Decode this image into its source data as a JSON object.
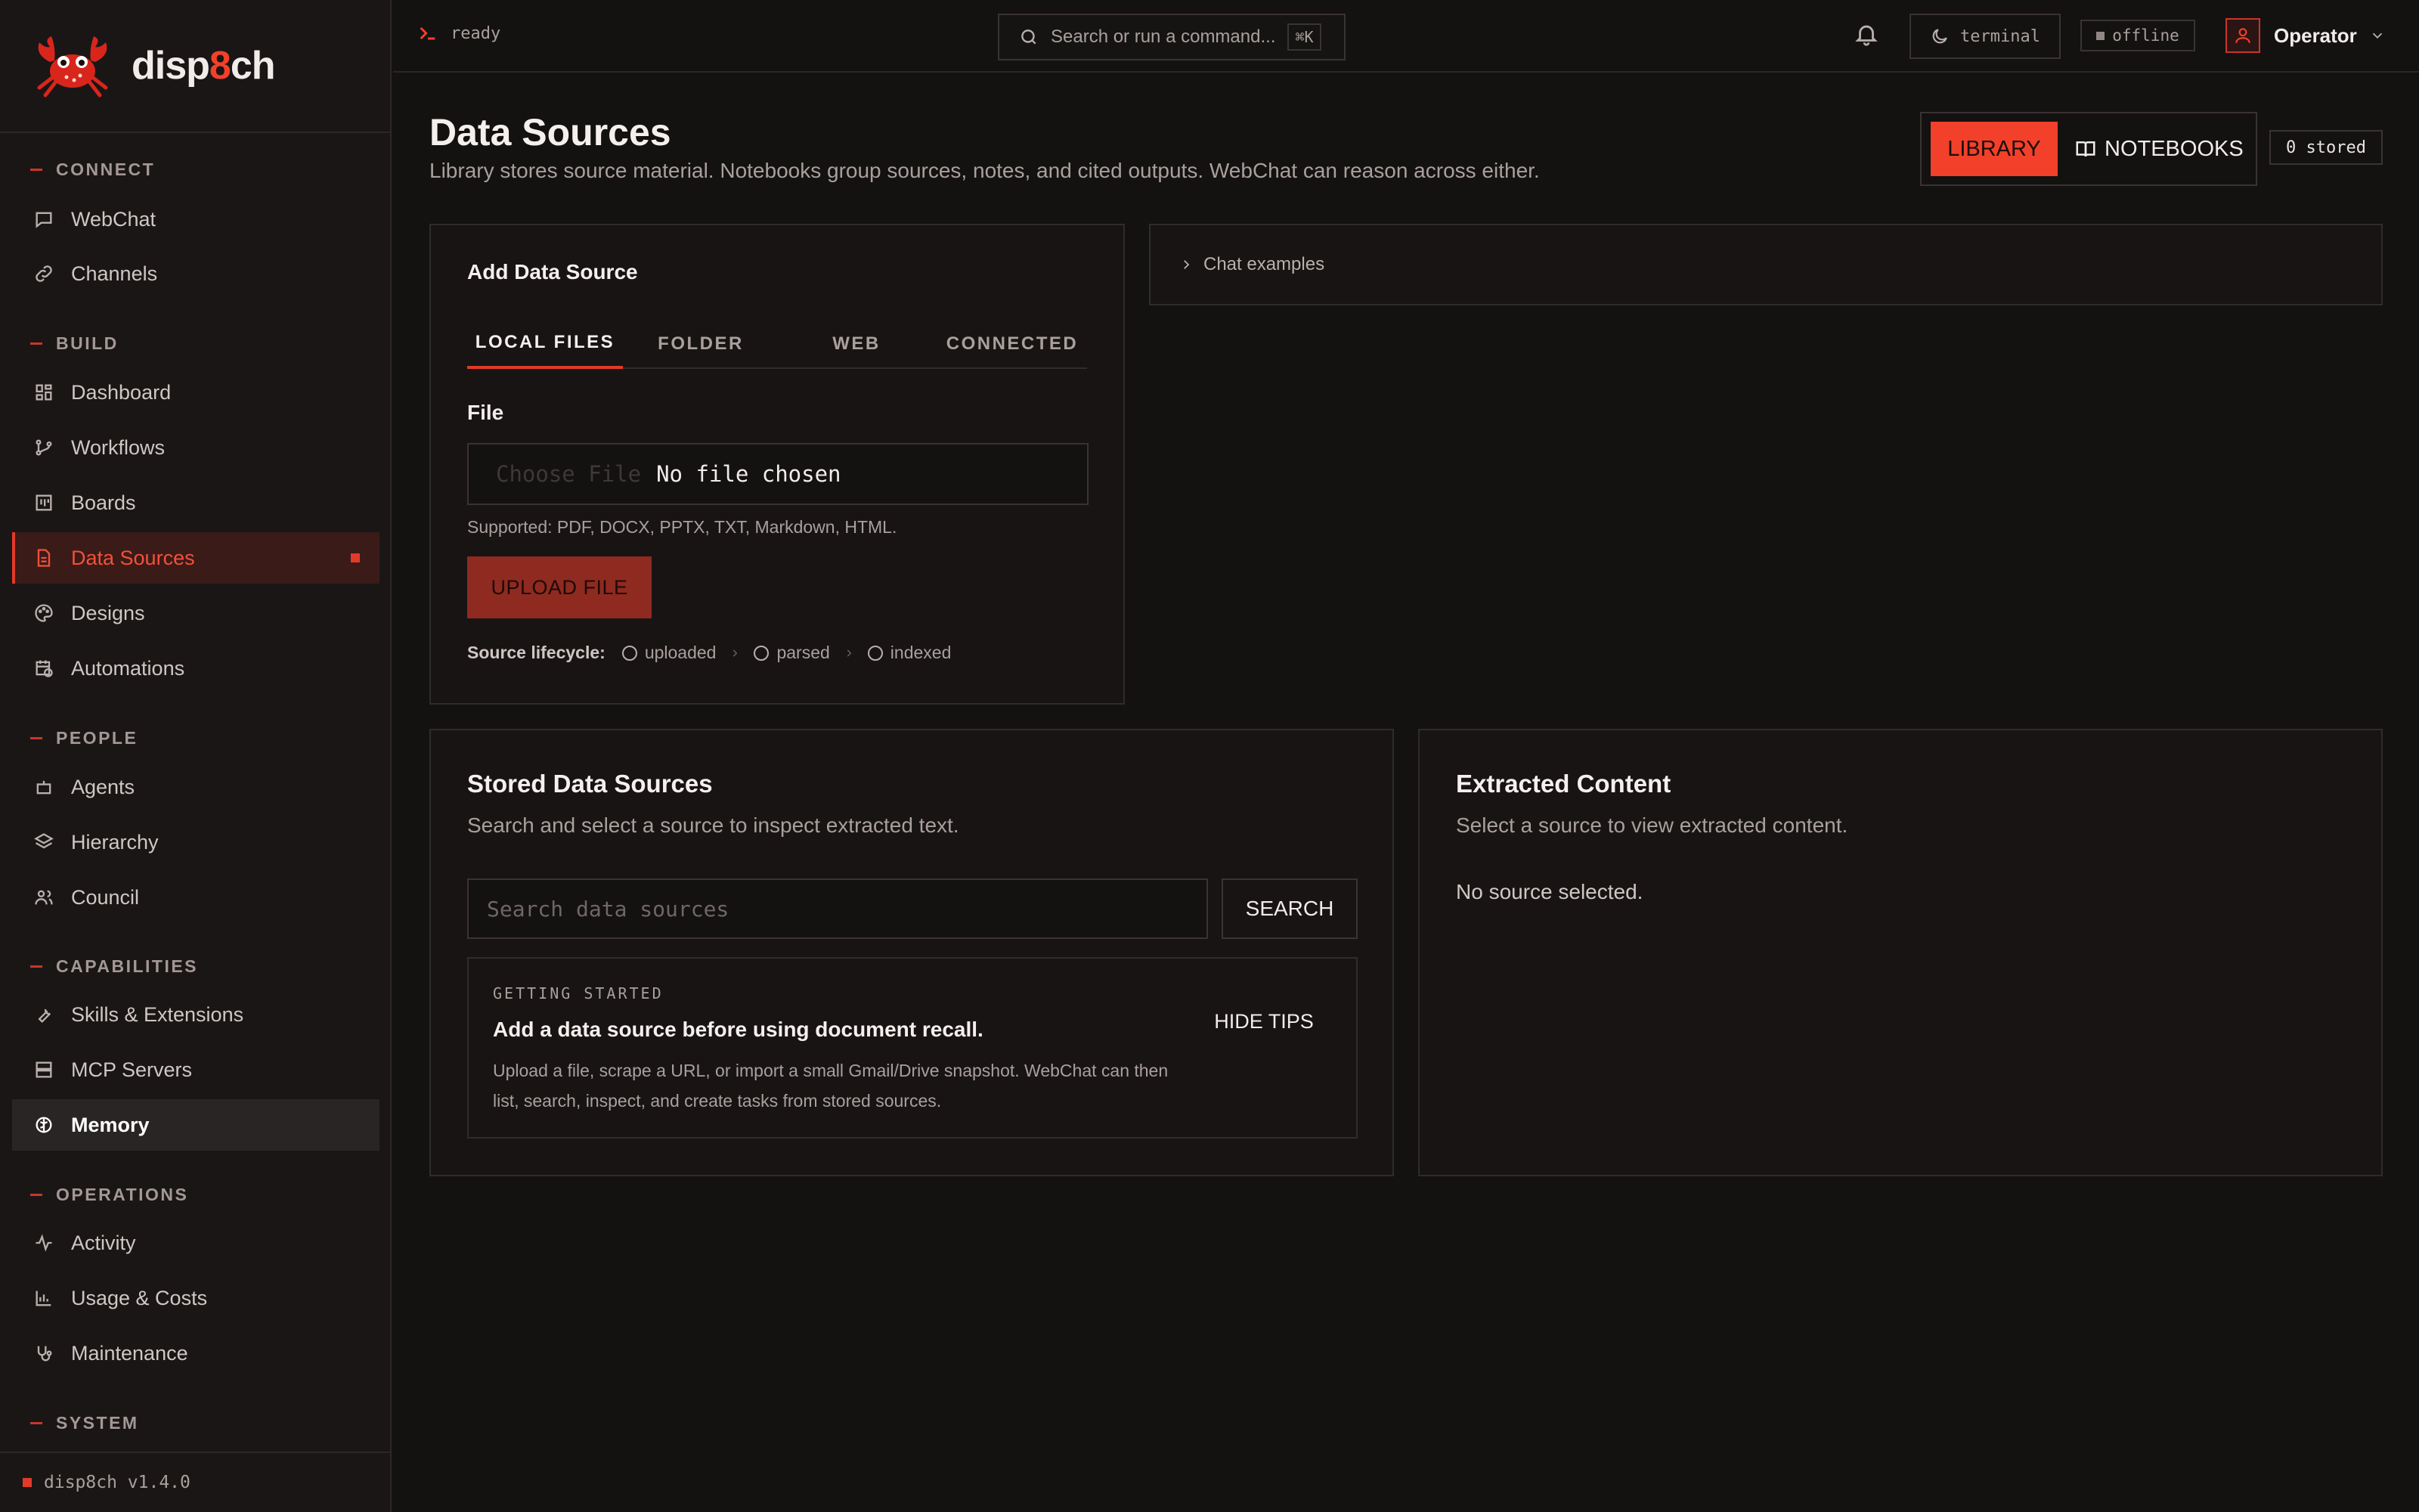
{
  "brand": {
    "name_prefix": "disp",
    "name_accent": "8",
    "name_suffix": "ch"
  },
  "sidebar": {
    "sections": {
      "connect": "CONNECT",
      "build": "BUILD",
      "people": "PEOPLE",
      "capabilities": "CAPABILITIES",
      "operations": "OPERATIONS",
      "system": "SYSTEM"
    },
    "items": {
      "webchat": {
        "label": "WebChat",
        "icon": "chat-icon"
      },
      "channels": {
        "label": "Channels",
        "icon": "link-icon"
      },
      "dashboard": {
        "label": "Dashboard",
        "icon": "grid-icon"
      },
      "workflows": {
        "label": "Workflows",
        "icon": "branch-icon"
      },
      "boards": {
        "label": "Boards",
        "icon": "board-icon"
      },
      "data_sources": {
        "label": "Data Sources",
        "icon": "document-icon",
        "active": true
      },
      "designs": {
        "label": "Designs",
        "icon": "palette-icon"
      },
      "automations": {
        "label": "Automations",
        "icon": "calendar-clock-icon"
      },
      "agents": {
        "label": "Agents",
        "icon": "robot-icon"
      },
      "hierarchy": {
        "label": "Hierarchy",
        "icon": "layers-icon"
      },
      "council": {
        "label": "Council",
        "icon": "users-icon"
      },
      "skills": {
        "label": "Skills & Extensions",
        "icon": "wrench-icon"
      },
      "mcp": {
        "label": "MCP Servers",
        "icon": "server-icon"
      },
      "memory": {
        "label": "Memory",
        "icon": "brain-icon"
      },
      "activity": {
        "label": "Activity",
        "icon": "pulse-icon"
      },
      "usage": {
        "label": "Usage & Costs",
        "icon": "bar-chart-icon"
      },
      "maintenance": {
        "label": "Maintenance",
        "icon": "stethoscope-icon"
      }
    },
    "version": "disp8ch v1.4.0"
  },
  "topbar": {
    "status": "ready",
    "search_placeholder": "Search or run a command...",
    "shortcut": "⌘K",
    "theme": "terminal",
    "connection": "offline",
    "user": "Operator"
  },
  "page": {
    "title": "Data Sources",
    "subtitle": "Library stores source material. Notebooks group sources, notes, and cited outputs. WebChat can reason across either.",
    "mode": {
      "library": "LIBRARY",
      "notebooks": "NOTEBOOKS"
    },
    "stored_count": "0 stored"
  },
  "add_source": {
    "title": "Add Data Source",
    "tabs": [
      "LOCAL FILES",
      "FOLDER",
      "WEB",
      "CONNECTED"
    ],
    "active_tab": "LOCAL FILES",
    "file_label": "File",
    "choose_file": "Choose File",
    "no_file": "No file chosen",
    "supported": "Supported: PDF, DOCX, PPTX, TXT, Markdown, HTML.",
    "upload_button": "UPLOAD FILE",
    "lifecycle_label": "Source lifecycle:",
    "lifecycle_steps": [
      "uploaded",
      "parsed",
      "indexed"
    ]
  },
  "chat_examples": {
    "label": "Chat examples"
  },
  "stored_sources": {
    "title": "Stored Data Sources",
    "subtitle": "Search and select a source to inspect extracted text.",
    "search_placeholder": "Search data sources",
    "search_button": "SEARCH",
    "tips": {
      "kicker": "GETTING STARTED",
      "title": "Add a data source before using document recall.",
      "body": "Upload a file, scrape a URL, or import a small Gmail/Drive snapshot. WebChat can then list, search, inspect, and create tasks from stored sources.",
      "hide_button": "HIDE TIPS"
    }
  },
  "extracted": {
    "title": "Extracted Content",
    "subtitle": "Select a source to view extracted content.",
    "empty": "No source selected."
  },
  "colors": {
    "accent": "#f2402a",
    "background": "#141111",
    "panel": "#181414",
    "border": "#312b2b",
    "muted_text": "#a9a09d"
  }
}
